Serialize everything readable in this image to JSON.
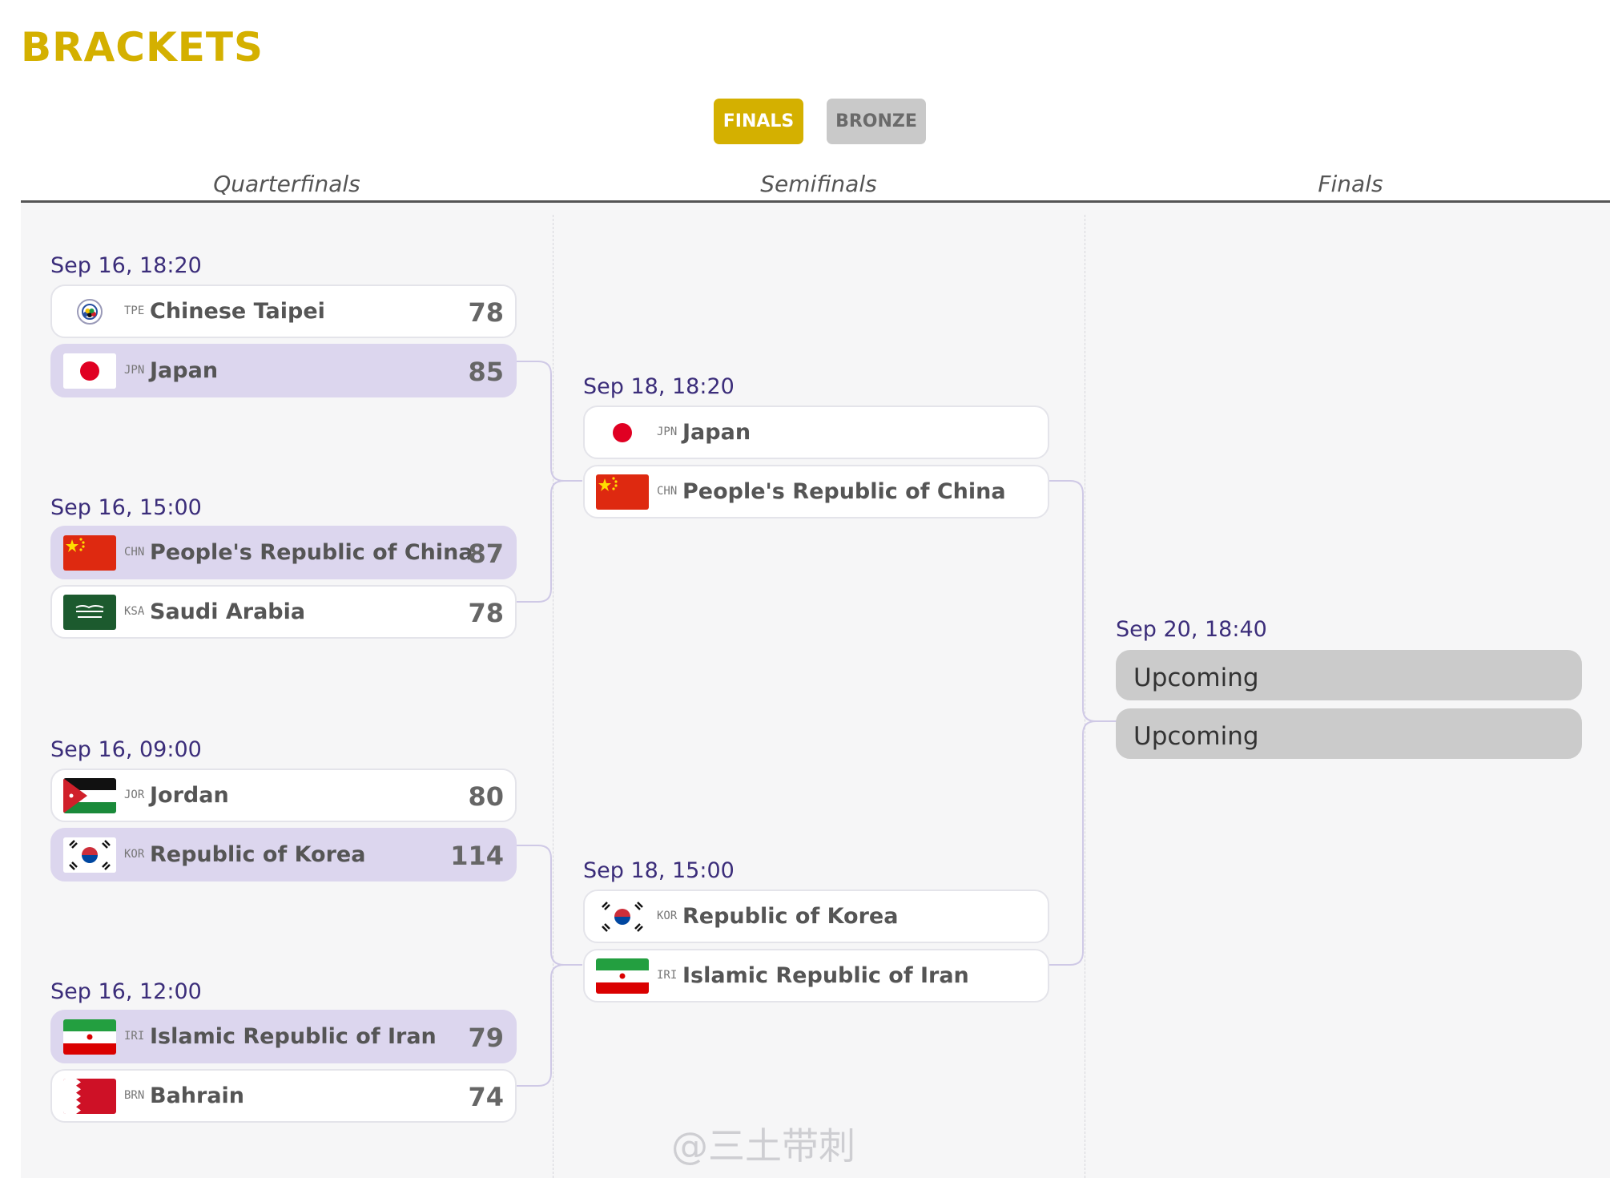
{
  "page": {
    "title": "BRACKETS"
  },
  "tabs": [
    {
      "label": "FINALS",
      "active": true
    },
    {
      "label": "BRONZE",
      "active": false
    }
  ],
  "rounds": [
    "Quarterfinals",
    "Semifinals",
    "Finals"
  ],
  "colors": {
    "accent": "#d4b000",
    "winner_row": "#dcd6ee",
    "date_text": "#3b2d7a",
    "upcoming_row": "#cbcbcb"
  },
  "quarterfinals": [
    {
      "date": "Sep 16, 18:20",
      "teams": [
        {
          "code": "TPE",
          "name": "Chinese Taipei",
          "score": "78",
          "flag": "chinese-taipei-flag-icon",
          "winner": false
        },
        {
          "code": "JPN",
          "name": "Japan",
          "score": "85",
          "flag": "japan-flag-icon",
          "winner": true
        }
      ]
    },
    {
      "date": "Sep 16, 15:00",
      "teams": [
        {
          "code": "CHN",
          "name": "People's Republic of China",
          "score": "87",
          "flag": "china-flag-icon",
          "winner": true
        },
        {
          "code": "KSA",
          "name": "Saudi Arabia",
          "score": "78",
          "flag": "saudi-arabia-flag-icon",
          "winner": false
        }
      ]
    },
    {
      "date": "Sep 16, 09:00",
      "teams": [
        {
          "code": "JOR",
          "name": "Jordan",
          "score": "80",
          "flag": "jordan-flag-icon",
          "winner": false
        },
        {
          "code": "KOR",
          "name": "Republic of Korea",
          "score": "114",
          "flag": "korea-flag-icon",
          "winner": true
        }
      ]
    },
    {
      "date": "Sep 16, 12:00",
      "teams": [
        {
          "code": "IRI",
          "name": "Islamic Republic of Iran",
          "score": "79",
          "flag": "iran-flag-icon",
          "winner": true
        },
        {
          "code": "BRN",
          "name": "Bahrain",
          "score": "74",
          "flag": "bahrain-flag-icon",
          "winner": false
        }
      ]
    }
  ],
  "semifinals": [
    {
      "date": "Sep 18, 18:20",
      "teams": [
        {
          "code": "JPN",
          "name": "Japan",
          "flag": "japan-flag-icon"
        },
        {
          "code": "CHN",
          "name": "People's Republic of China",
          "flag": "china-flag-icon"
        }
      ]
    },
    {
      "date": "Sep 18, 15:00",
      "teams": [
        {
          "code": "KOR",
          "name": "Republic of Korea",
          "flag": "korea-flag-icon"
        },
        {
          "code": "IRI",
          "name": "Islamic Republic of Iran",
          "flag": "iran-flag-icon"
        }
      ]
    }
  ],
  "finals": [
    {
      "date": "Sep 20, 18:40",
      "slots": [
        "Upcoming",
        "Upcoming"
      ]
    }
  ],
  "watermark": "@三土带刺"
}
